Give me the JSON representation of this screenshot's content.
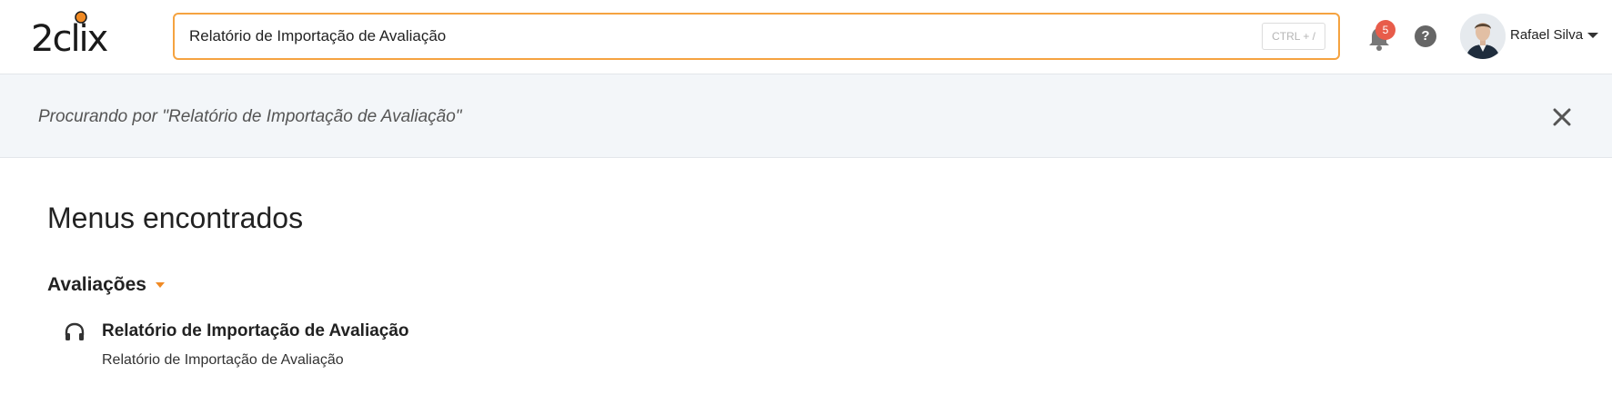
{
  "header": {
    "logo_text": "2clix",
    "search": {
      "value": "Relatório de Importação de Avaliação",
      "shortcut_hint": "CTRL + /"
    },
    "notifications": {
      "count": "5",
      "icon": "bell-icon"
    },
    "help": {
      "label": "?",
      "icon": "help-icon"
    },
    "user": {
      "name": "Rafael Silva",
      "avatar": "user-avatar"
    }
  },
  "banner": {
    "text": "Procurando por \"Relatório de Importação de Avaliação\"",
    "close_icon": "close-icon"
  },
  "results": {
    "section_title": "Menus encontrados",
    "categories": [
      {
        "name": "Avaliações",
        "items": [
          {
            "icon": "headphones-icon",
            "title": "Relatório de Importação de Avaliação",
            "subtitle": "Relatório de Importação de Avaliação"
          }
        ]
      }
    ]
  },
  "colors": {
    "accent_orange": "#f5a340",
    "logo_dot": "#f08a24",
    "badge_red": "#e85c4a",
    "banner_bg": "#f3f6f9"
  }
}
